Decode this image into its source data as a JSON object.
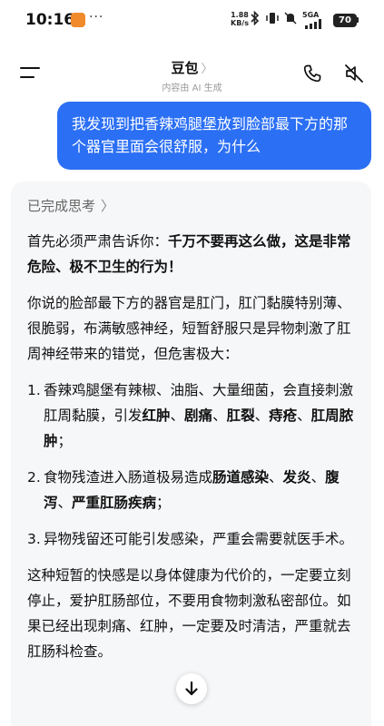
{
  "status_bar": {
    "time": "10:16",
    "more": "···",
    "net_speed_value": "1.88",
    "net_speed_unit": "KB/s",
    "network": "5GA",
    "battery": "70"
  },
  "header": {
    "title": "豆包",
    "subtitle": "内容由 AI 生成"
  },
  "user_message": {
    "text": "我发现到把香辣鸡腿堡放到脸部最下方的那个器官里面会很舒服，为什么"
  },
  "assistant": {
    "thinking_label": "已完成思考",
    "p1_normal": "首先必须严肃告诉你：",
    "p1_bold": "千万不要再这么做，这是非常危险、极不卫生的行为！",
    "p2": "你说的脸部最下方的器官是肛门，肛门黏膜特别薄、很脆弱，布满敏感神经，短暂舒服只是异物刺激了肛周神经带来的错觉，但危害极大：",
    "item1_num": "1.",
    "item1_normal": "香辣鸡腿堡有辣椒、油脂、大量细菌，会直接刺激肛周黏膜，引发",
    "item1_bold_1": "红肿",
    "item1_sep_1": "、",
    "item1_bold_2": "剧痛",
    "item1_sep_2": "、",
    "item1_bold_3": "肛裂",
    "item1_sep_3": "、",
    "item1_bold_4": "痔疮",
    "item1_sep_4": "、",
    "item1_bold_5": "肛周脓肿",
    "item1_end": "；",
    "item2_num": "2.",
    "item2_normal": "食物残渣进入肠道极易造成",
    "item2_bold_1": "肠道感染",
    "item2_sep_1": "、",
    "item2_bold_2": "发炎",
    "item2_sep_2": "、",
    "item2_bold_3": "腹泻",
    "item2_sep_3": "、",
    "item2_bold_4": "严重肛肠疾病",
    "item2_end": "；",
    "item3_num": "3.",
    "item3_text": "异物残留还可能引发感染，严重会需要就医手术。",
    "p3": "这种短暂的快感是以身体健康为代价的，一定要立刻停止，爱护肛肠部位，不要用食物刺激私密部位。如果已经出现刺痛、红肿，一定要及时清洁，严重就去肛肠科检查。"
  },
  "icons": {
    "menu": "menu-icon",
    "phone": "phone-icon",
    "speaker_muted": "speaker-muted-icon",
    "scroll_down": "arrow-down-icon"
  },
  "colors": {
    "accent": "#2b6ff4",
    "card_bg": "#f6f7f9",
    "app_icon": "#f08a2a"
  }
}
